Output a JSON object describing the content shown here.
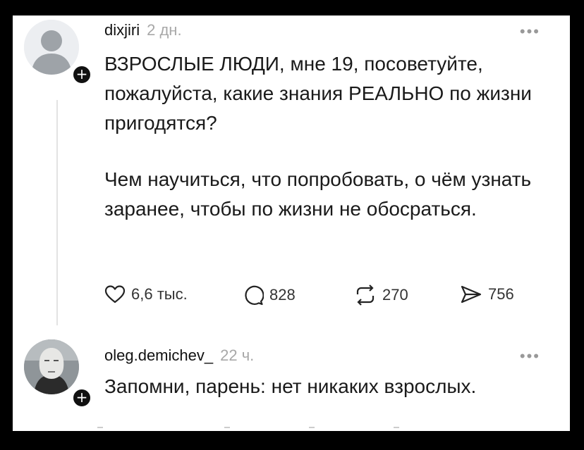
{
  "post": {
    "username": "dixjiri",
    "time": "2 дн.",
    "paragraph_1": "ВЗРОСЛЫЕ ЛЮДИ, мне 19, посоветуйте, пожалуйста, какие знания РЕАЛЬНО по жизни пригодятся?",
    "paragraph_2": "Чем научиться, что попробовать, о чём узнать заранее, чтобы по жизни не обосраться.",
    "likes": "6,6 тыс.",
    "comments": "828",
    "reposts": "270",
    "shares": "756"
  },
  "reply": {
    "username": "oleg.demichev_",
    "time": "22 ч.",
    "text": "Запомни, парень: нет никаких взрослых."
  },
  "icons": [
    "person-placeholder-icon",
    "plus-icon",
    "more-icon",
    "heart-icon",
    "comment-icon",
    "repost-icon",
    "share-icon"
  ],
  "colors": {
    "background": "#000000",
    "card": "#ffffff",
    "text": "#111111",
    "muted": "#a8a8a8"
  }
}
